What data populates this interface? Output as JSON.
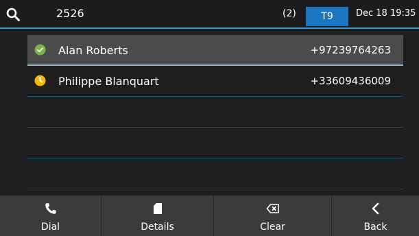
{
  "header": {
    "search_icon": "search-icon",
    "search_query": "2526",
    "result_count": "(2)",
    "input_mode": "T9",
    "datetime": "Dec 18 19:35"
  },
  "contacts": [
    {
      "name": "Alan Roberts",
      "number": "+97239764263",
      "status": "available",
      "status_color": "#7cb342",
      "selected": true
    },
    {
      "name": "Philippe Blanquart",
      "number": "+33609436009",
      "status": "away",
      "status_color": "#f5b800",
      "selected": false
    }
  ],
  "softkeys": [
    {
      "label": "Dial",
      "icon": "phone-icon"
    },
    {
      "label": "Details",
      "icon": "document-icon"
    },
    {
      "label": "Clear",
      "icon": "backspace-icon"
    },
    {
      "label": "Back",
      "icon": "chevron-left-icon"
    }
  ],
  "colors": {
    "accent": "#1a76c0",
    "background": "#1e1e1e",
    "softkey_bar": "#3b3b3b",
    "selected_row": "#4b4b4b"
  }
}
